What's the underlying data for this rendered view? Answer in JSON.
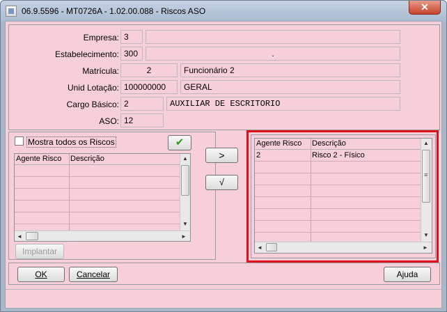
{
  "window": {
    "title": "06.9.5596 - MT0726A - 1.02.00.088 - Riscos ASO",
    "close_symbol": "✕",
    "colors": {
      "client_bg": "#f6cfd9",
      "highlight": "#e0101a"
    }
  },
  "form": {
    "empresa": {
      "label": "Empresa:",
      "code": "3",
      "desc": ""
    },
    "estabelecimento": {
      "label": "Estabelecimento:",
      "code": "300",
      "desc": "."
    },
    "matricula": {
      "label": "Matrícula:",
      "code": "2",
      "desc": "Funcionário 2"
    },
    "unid_lotacao": {
      "label": "Unid Lotação:",
      "code": "100000000",
      "desc": "GERAL"
    },
    "cargo_basico": {
      "label": "Cargo Básico:",
      "code": "2",
      "desc": "AUXILIAR DE ESCRITORIO"
    },
    "aso": {
      "label": "ASO:",
      "code": "12"
    }
  },
  "left_panel": {
    "show_all_label": "Mostra todos os Riscos",
    "confirm_icon": "✔",
    "columns": [
      "Agente Risco",
      "Descrição"
    ],
    "rows": [],
    "implantar_label": "Implantar"
  },
  "transfer": {
    "add_symbol": ">",
    "remove_symbol": "√"
  },
  "right_panel": {
    "columns": [
      "Agente Risco",
      "Descrição"
    ],
    "rows": [
      {
        "agente": "2",
        "descricao": "Risco 2 - Físico"
      }
    ]
  },
  "scroll_symbols": {
    "left": "◄",
    "right": "►",
    "up": "▲",
    "down": "▼",
    "grip": "≡"
  },
  "footer": {
    "ok_label": "OK",
    "cancel_label": "Cancelar",
    "help_label": "Ajuda"
  }
}
